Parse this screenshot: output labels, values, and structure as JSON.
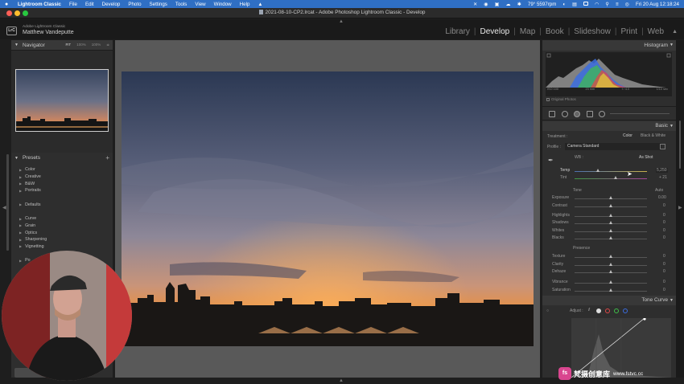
{
  "menubar": {
    "app_name": "Lightroom Classic",
    "items": [
      "File",
      "Edit",
      "Develop",
      "Photo",
      "Settings",
      "Tools",
      "View",
      "Window",
      "Help"
    ],
    "status_text": "79° 5597rpm",
    "clock": "Fri 20 Aug  12:18:24"
  },
  "window": {
    "title": "2021-08-10-CP2.lrcat - Adobe Photoshop Lightroom Classic - Develop",
    "traffic_colors": [
      "#ff5f57",
      "#febc2e",
      "#28c840"
    ]
  },
  "identity": {
    "logo": "LrC",
    "line1": "Adobe Lightroom Classic",
    "line2": "Matthew Vandeputte"
  },
  "modules": {
    "items": [
      "Library",
      "Develop",
      "Map",
      "Book",
      "Slideshow",
      "Print",
      "Web"
    ],
    "active": "Develop"
  },
  "navigator": {
    "title": "Navigator",
    "zoom_options": [
      "FIT",
      "100%",
      "100%"
    ]
  },
  "presets": {
    "title": "Presets",
    "groups": [
      "Color",
      "Creative",
      "B&W",
      "Portraits",
      "",
      "Defaults",
      "",
      "Curve",
      "Grain",
      "Optics",
      "Sharpening",
      "Vignetting",
      "",
      "Po"
    ]
  },
  "right": {
    "histogram_title": "Histogram",
    "histogram_labels": [
      "ISO 100",
      "23 mm",
      "f / 4.0",
      "1/10 sec"
    ],
    "original_photos": "Original Photos",
    "basic": {
      "title": "Basic",
      "treatment_label": "Treatment :",
      "treatment_color": "Color",
      "treatment_bw": "Black & White",
      "profile_label": "Profile :",
      "profile_value": "Camera Standard",
      "wb_label": "WB :",
      "wb_value": "As Shot",
      "temp_label": "Temp",
      "temp_value": "5,250",
      "tint_label": "Tint",
      "tint_value": "+ 21",
      "tone_label": "Tone",
      "tone_auto": "Auto",
      "tone_sliders": [
        {
          "label": "Exposure",
          "value": "0.00"
        },
        {
          "label": "Contrast",
          "value": "0"
        },
        {
          "label": "Highlights",
          "value": "0"
        },
        {
          "label": "Shadows",
          "value": "0"
        },
        {
          "label": "Whites",
          "value": "0"
        },
        {
          "label": "Blacks",
          "value": "0"
        }
      ],
      "presence_label": "Presence",
      "presence_sliders": [
        {
          "label": "Texture",
          "value": "0"
        },
        {
          "label": "Clarity",
          "value": "0"
        },
        {
          "label": "Dehaze",
          "value": "0"
        },
        {
          "label": "Vibrance",
          "value": "0"
        },
        {
          "label": "Saturation",
          "value": "0"
        }
      ]
    },
    "tone_curve": {
      "title": "Tone Curve",
      "adjust_label": "Adjust :"
    }
  },
  "watermark": {
    "logo": "fs",
    "cn": "梵摄创意库",
    "url": "www.fstvc.cc"
  }
}
